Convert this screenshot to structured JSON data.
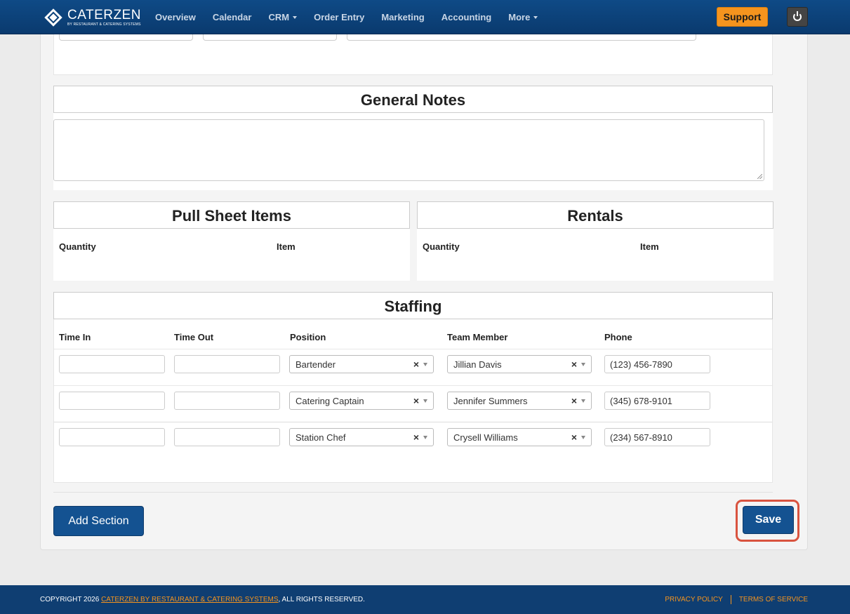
{
  "brand": {
    "name": "CATERZEN",
    "tagline": "BY RESTAURANT & CATERING SYSTEMS"
  },
  "nav": {
    "items": [
      {
        "label": "Overview",
        "dropdown": false
      },
      {
        "label": "Calendar",
        "dropdown": false
      },
      {
        "label": "CRM",
        "dropdown": true
      },
      {
        "label": "Order Entry",
        "dropdown": false
      },
      {
        "label": "Marketing",
        "dropdown": false
      },
      {
        "label": "Accounting",
        "dropdown": false
      },
      {
        "label": "More",
        "dropdown": true
      }
    ],
    "support_label": "Support"
  },
  "general_notes": {
    "title": "General Notes",
    "value": ""
  },
  "pull_sheet": {
    "title": "Pull Sheet Items",
    "columns": [
      "Quantity",
      "Item"
    ]
  },
  "rentals": {
    "title": "Rentals",
    "columns": [
      "Quantity",
      "Item"
    ]
  },
  "staffing": {
    "title": "Staffing",
    "columns": [
      "Time In",
      "Time Out",
      "Position",
      "Team Member",
      "Phone"
    ],
    "rows": [
      {
        "time_in": "",
        "time_out": "",
        "position": "Bartender",
        "team_member": "Jillian Davis",
        "phone": "(123) 456-7890"
      },
      {
        "time_in": "",
        "time_out": "",
        "position": "Catering Captain",
        "team_member": "Jennifer Summers",
        "phone": "(345) 678-9101"
      },
      {
        "time_in": "",
        "time_out": "",
        "position": "Station Chef",
        "team_member": "Crysell Williams",
        "phone": "(234) 567-8910"
      }
    ]
  },
  "actions": {
    "add_section_label": "Add Section",
    "save_label": "Save",
    "clear_glyph": "×"
  },
  "footer": {
    "copyright_prefix": "COPYRIGHT 2026",
    "company_link": "CATERZEN BY RESTAURANT & CATERING SYSTEMS",
    "copyright_suffix": ", ALL RIGHTS RESERVED.",
    "privacy_label": "PRIVACY POLICY",
    "terms_label": "TERMS OF SERVICE"
  },
  "colors": {
    "navbar": "#0f4a86",
    "accent": "#f5941e",
    "primary_button": "#145291",
    "highlight": "#d9533f",
    "footer": "#0f3e72"
  }
}
